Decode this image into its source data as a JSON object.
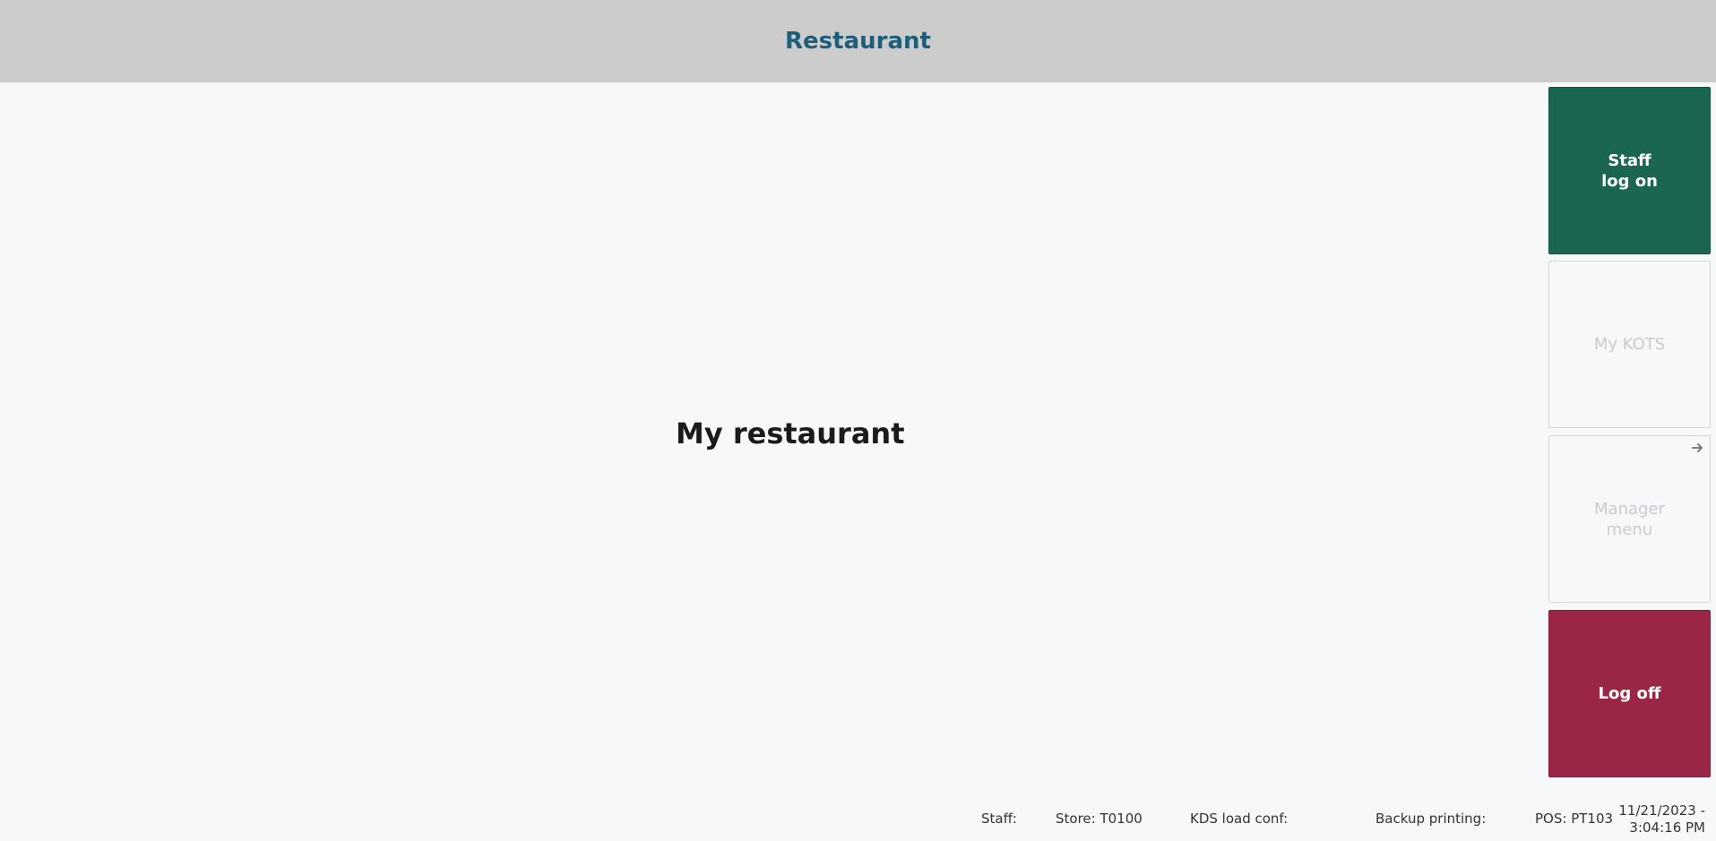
{
  "header": {
    "title": "Restaurant"
  },
  "main": {
    "title": "My restaurant"
  },
  "tiles": {
    "staff_log_on": "Staff\nlog on",
    "my_kots": "My KOTS",
    "manager_menu": "Manager\nmenu",
    "log_off": "Log off"
  },
  "status": {
    "staff": "Staff:",
    "store": "Store: T0100",
    "kds": "KDS load conf:",
    "backup": "Backup printing:",
    "pos": "POS: PT103",
    "date": "11/21/2023 -",
    "time": "3:04:16 PM"
  },
  "colors": {
    "header_bg": "#cccccc",
    "header_title": "#1d5f7a",
    "staff_tile": "#1b6651",
    "logoff_tile": "#9b2544",
    "disabled_text": "#c8cbd0"
  },
  "icons": {
    "manager_menu_arrow": "arrow-right-icon"
  }
}
